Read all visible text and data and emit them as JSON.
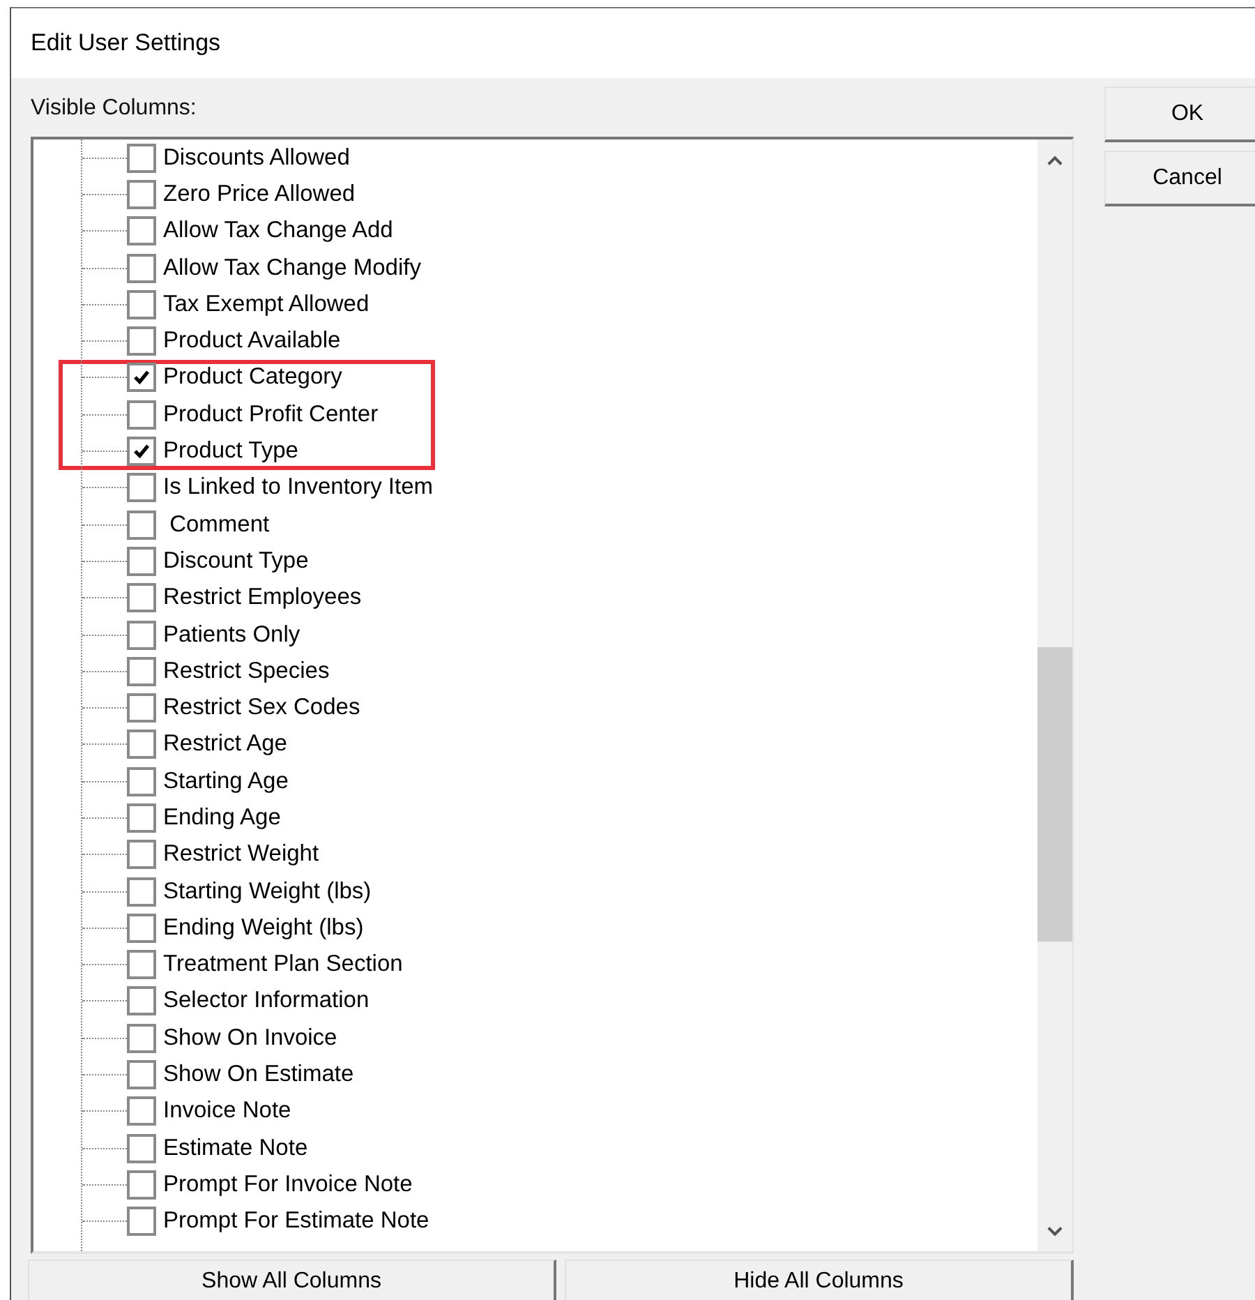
{
  "window": {
    "title": "Edit User Settings"
  },
  "visible_columns": {
    "label": "Visible Columns:",
    "items": [
      {
        "label": "Discounts Allowed",
        "checked": false,
        "highlighted": false
      },
      {
        "label": "Zero Price Allowed",
        "checked": false,
        "highlighted": false
      },
      {
        "label": "Allow Tax Change Add",
        "checked": false,
        "highlighted": false
      },
      {
        "label": "Allow Tax Change Modify",
        "checked": false,
        "highlighted": false
      },
      {
        "label": "Tax Exempt Allowed",
        "checked": false,
        "highlighted": false
      },
      {
        "label": "Product Available",
        "checked": false,
        "highlighted": false
      },
      {
        "label": "Product Category",
        "checked": true,
        "highlighted": true
      },
      {
        "label": "Product Profit Center",
        "checked": false,
        "highlighted": true
      },
      {
        "label": "Product Type",
        "checked": true,
        "highlighted": true
      },
      {
        "label": "Is Linked to Inventory Item",
        "checked": false,
        "highlighted": false
      },
      {
        "label": " Comment",
        "checked": false,
        "highlighted": false
      },
      {
        "label": "Discount Type",
        "checked": false,
        "highlighted": false
      },
      {
        "label": "Restrict Employees",
        "checked": false,
        "highlighted": false
      },
      {
        "label": "Patients Only",
        "checked": false,
        "highlighted": false
      },
      {
        "label": "Restrict Species",
        "checked": false,
        "highlighted": false
      },
      {
        "label": "Restrict Sex Codes",
        "checked": false,
        "highlighted": false
      },
      {
        "label": "Restrict Age",
        "checked": false,
        "highlighted": false
      },
      {
        "label": "Starting Age",
        "checked": false,
        "highlighted": false
      },
      {
        "label": "Ending Age",
        "checked": false,
        "highlighted": false
      },
      {
        "label": "Restrict Weight",
        "checked": false,
        "highlighted": false
      },
      {
        "label": "Starting Weight (lbs)",
        "checked": false,
        "highlighted": false
      },
      {
        "label": "Ending Weight (lbs)",
        "checked": false,
        "highlighted": false
      },
      {
        "label": "Treatment Plan Section",
        "checked": false,
        "highlighted": false
      },
      {
        "label": "Selector Information",
        "checked": false,
        "highlighted": false
      },
      {
        "label": "Show On Invoice",
        "checked": false,
        "highlighted": false
      },
      {
        "label": "Show On Estimate",
        "checked": false,
        "highlighted": false
      },
      {
        "label": "Invoice Note",
        "checked": false,
        "highlighted": false
      },
      {
        "label": "Estimate Note",
        "checked": false,
        "highlighted": false
      },
      {
        "label": "Prompt For Invoice Note",
        "checked": false,
        "highlighted": false
      },
      {
        "label": "Prompt For Estimate Note",
        "checked": false,
        "highlighted": false
      }
    ]
  },
  "side_buttons": [
    {
      "label": "OK"
    },
    {
      "label": "Cancel"
    }
  ],
  "bottom_buttons": [
    {
      "label": "Show All Columns"
    },
    {
      "label": "Hide All Columns"
    }
  ]
}
